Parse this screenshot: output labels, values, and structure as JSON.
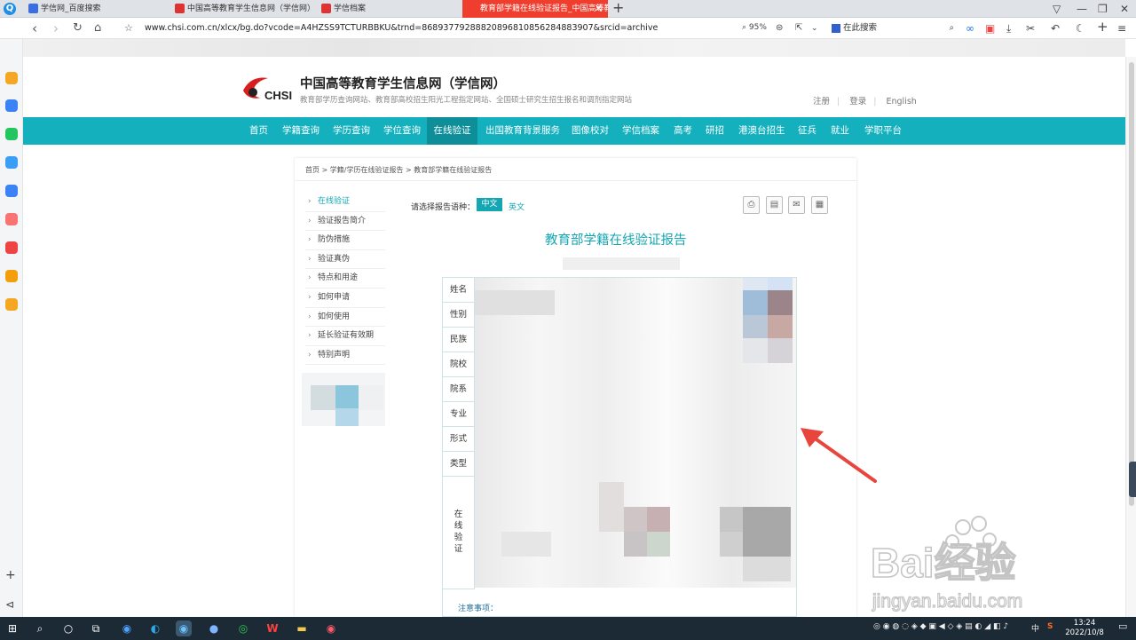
{
  "tabs": [
    {
      "label": "学信网_百度搜索"
    },
    {
      "label": "中国高等教育学生信息网（学信网）"
    },
    {
      "label": "学信档案"
    },
    {
      "label": "教育部学籍在线验证报告_中国高等教"
    }
  ],
  "address": {
    "url": "www.chsi.com.cn/xlcx/bg.do?vcode=A4HZSS9TCTURBBKU&trnd=86893779288820896810856284883907&srcid=archive",
    "zoom": "95%",
    "search_label": "在此搜索"
  },
  "site": {
    "title": "中国高等教育学生信息网（学信网）",
    "subtitle": "教育部学历查询网站、教育部高校招生阳光工程指定网站、全国硕士研究生招生报名和调剂指定网站",
    "logo_text": "CHSI",
    "register": "注册",
    "login": "登录",
    "english": "English"
  },
  "nav": [
    "首页",
    "学籍查询",
    "学历查询",
    "学位查询",
    "在线验证",
    "出国教育背景服务",
    "图像校对",
    "学信档案",
    "高考",
    "研招",
    "港澳台招生",
    "征兵",
    "就业",
    "学职平台"
  ],
  "breadcrumb": "首页 > 学籍/学历在线验证报告 > 教育部学籍在线验证报告",
  "sidemenu": [
    "在线验证",
    "验证报告简介",
    "防伪措施",
    "验证真伪",
    "特点和用途",
    "如何申请",
    "如何使用",
    "延长验证有效期",
    "特别声明"
  ],
  "lang": {
    "label": "请选择报告语种：",
    "zh": "中文",
    "en": "英文"
  },
  "report": {
    "title": "教育部学籍在线验证报告",
    "fields": [
      "姓名",
      "性别",
      "民族",
      "院校",
      "院系",
      "专业",
      "形式",
      "类型"
    ],
    "verify_label": "在\n线\n验\n证",
    "notes_label": "注意事项："
  },
  "watermark": {
    "brand": "Bai经验",
    "url": "jingyan.baidu.com"
  },
  "clock": {
    "time": "13:24",
    "date": "2022/10/8"
  },
  "tray": {
    "ime": "中",
    "sohu": "S"
  },
  "colors": {
    "accent": "#14b0bd",
    "tab_active": "#ef3d2e",
    "arrow": "#e8463d"
  }
}
